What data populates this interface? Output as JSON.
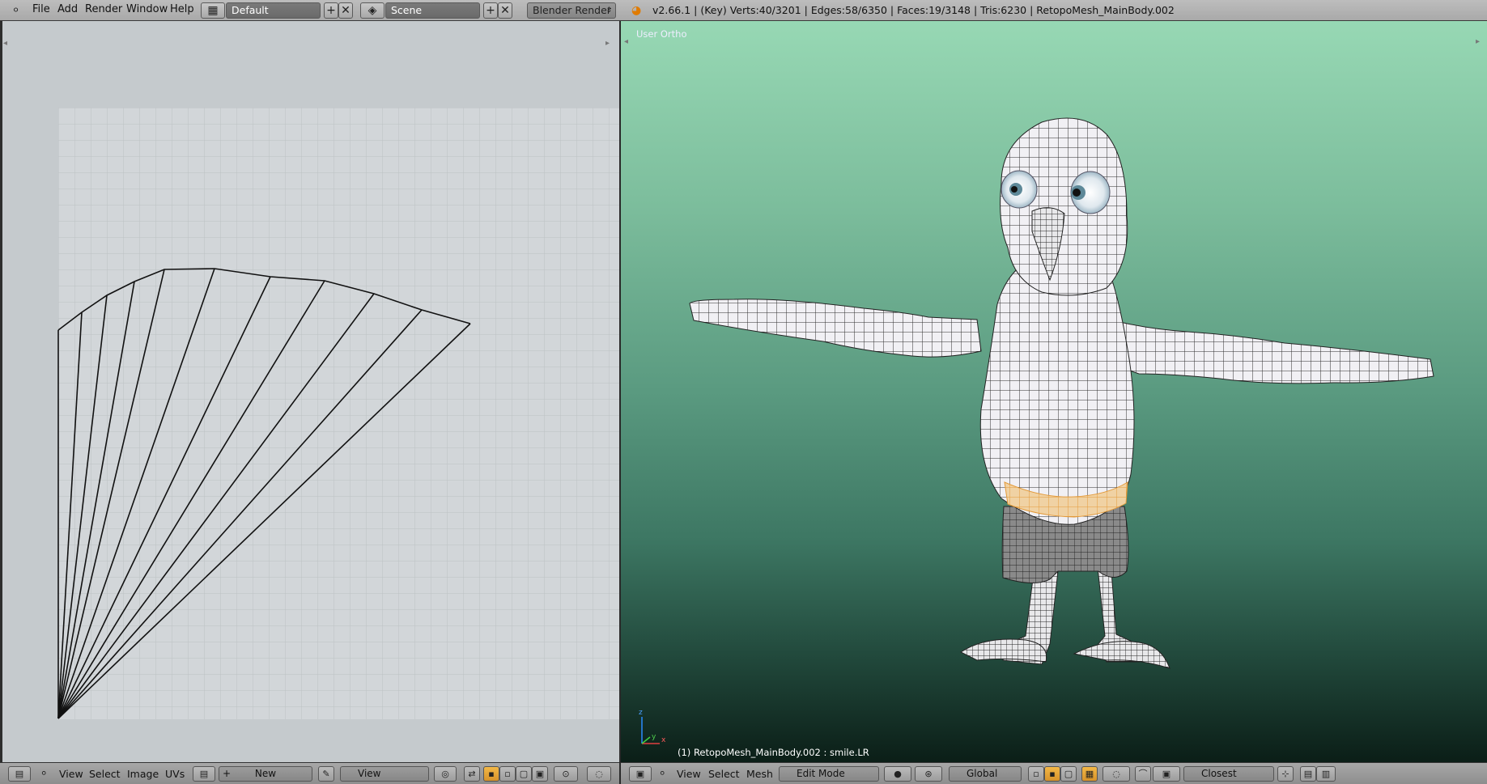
{
  "topbar": {
    "menus": [
      "File",
      "Add",
      "Render",
      "Window",
      "Help"
    ],
    "screen_layout": "Default",
    "scene": "Scene",
    "render_engine": "Blender Render",
    "info": "v2.66.1 | (Key) Verts:40/3201 | Edges:58/6350 | Faces:19/3148 | Tris:6230 | RetopoMesh_MainBody.002"
  },
  "uv_editor": {
    "header_menus": [
      "View",
      "Select",
      "Image",
      "UVs"
    ],
    "new_button": "New",
    "view_dropdown": "View"
  },
  "viewport": {
    "view_label": "User Ortho",
    "object_label": "(1) RetopoMesh_MainBody.002 : smile.LR",
    "header_menus": [
      "View",
      "Select",
      "Mesh"
    ],
    "mode": "Edit Mode",
    "orientation": "Global",
    "snap_target": "Closest",
    "axis_labels": {
      "x": "x",
      "y": "y",
      "z": "z"
    }
  },
  "colors": {
    "accent": "#f0a830",
    "uv_background": "#c5cacd",
    "viewport_top": "#97d8b4",
    "viewport_bottom": "#0b1e17"
  }
}
